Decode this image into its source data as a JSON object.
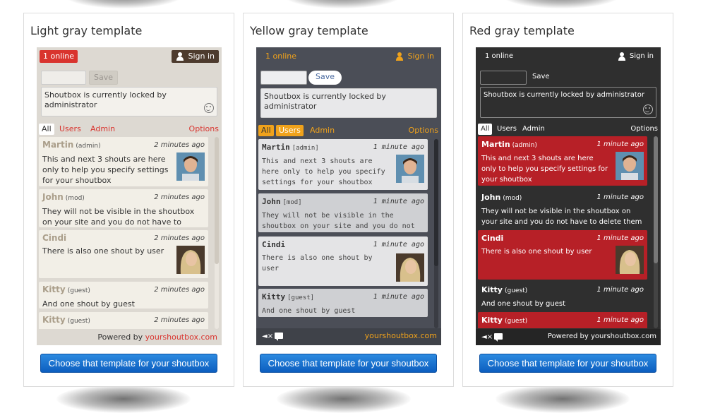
{
  "templates": [
    {
      "title": "Light gray template",
      "online": "1 online",
      "signin": "Sign in",
      "save": "Save",
      "message": "Shoutbox is currently locked by administrator",
      "tabs": [
        "All",
        "Users",
        "Admin"
      ],
      "options": "Options",
      "shouts": [
        {
          "name": "Martin",
          "role": "(admin)",
          "time": "2 minutes ago",
          "text": "This and next 3 shouts are here only to help you specify settings for your shoutbox"
        },
        {
          "name": "John",
          "role": "(mod)",
          "time": "2 minutes ago",
          "text": "They will not be visible in the shoutbox on your site and you do not have to delete them"
        },
        {
          "name": "Cindi",
          "role": "",
          "time": "2 minutes ago",
          "text": "There is also one shout by user"
        },
        {
          "name": "Kitty",
          "role": "(guest)",
          "time": "2 minutes ago",
          "text": "And one shout by guest"
        },
        {
          "name": "Kitty",
          "role": "(guest)",
          "time": "2 minutes ago",
          "text": ""
        }
      ],
      "powered_prefix": "Powered by",
      "brand": "yourshoutbox.com",
      "button": "Choose that template for your shoutbox"
    },
    {
      "title": "Yellow gray template",
      "online": "1 online",
      "signin": "Sign in",
      "save": "Save",
      "message": "Shoutbox is currently locked by administrator",
      "tabs": [
        "All",
        "Users",
        "Admin"
      ],
      "options": "Options",
      "shouts": [
        {
          "name": "Martin",
          "role": "[admin]",
          "time": "1 minute ago",
          "text": "This and next 3 shouts are here only to help you specify settings for your shoutbox"
        },
        {
          "name": "John",
          "role": "[mod]",
          "time": "1 minute ago",
          "text": "They will not be visible in the shoutbox on your site and you do not have to delete them"
        },
        {
          "name": "Cindi",
          "role": "",
          "time": "1 minute ago",
          "text": "There is also one shout by user"
        },
        {
          "name": "Kitty",
          "role": "[guest]",
          "time": "1 minute ago",
          "text": "And one shout by guest"
        }
      ],
      "brand": "yourshoutbox.com",
      "button": "Choose that template for your shoutbox"
    },
    {
      "title": "Red gray template",
      "online": "1 online",
      "signin": "Sign in",
      "save": "Save",
      "message": "Shoutbox is currently locked by administrator",
      "tabs": [
        "All",
        "Users",
        "Admin"
      ],
      "options": "Options",
      "shouts": [
        {
          "name": "Martin",
          "role": "(admin)",
          "time": "1 minute ago",
          "text": "This and next 3 shouts are here only to help you specify settings for your shoutbox"
        },
        {
          "name": "John",
          "role": "(mod)",
          "time": "1 minute ago",
          "text": "They will not be visible in the shoutbox on your site and you do not have to delete them"
        },
        {
          "name": "Cindi",
          "role": "",
          "time": "1 minute ago",
          "text": "There is also one shout by user"
        },
        {
          "name": "Kitty",
          "role": "(guest)",
          "time": "1 minute ago",
          "text": "And one shout by guest"
        },
        {
          "name": "Kitty",
          "role": "(guest)",
          "time": "1 minute ago",
          "text": ""
        }
      ],
      "powered_prefix": "Powered by",
      "brand": "yourshoutbox.com",
      "button": "Choose that template for your shoutbox"
    }
  ],
  "icons": {
    "user": "user-icon",
    "smiley": "smiley-icon",
    "sound": "sound-off-icon",
    "chat": "chat-icon",
    "avatar": "avatar-photo"
  },
  "colors": {
    "light_accent": "#d9342e",
    "yellow_accent": "#f0a21b",
    "red_accent": "#b72027",
    "button_blue": "#1a72d0"
  }
}
